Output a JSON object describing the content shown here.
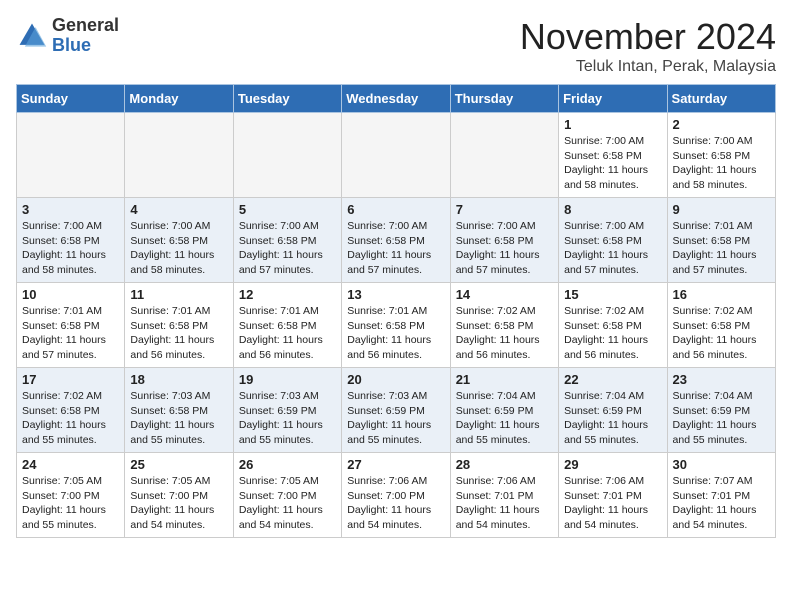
{
  "header": {
    "logo_general": "General",
    "logo_blue": "Blue",
    "month_title": "November 2024",
    "location": "Teluk Intan, Perak, Malaysia"
  },
  "weekdays": [
    "Sunday",
    "Monday",
    "Tuesday",
    "Wednesday",
    "Thursday",
    "Friday",
    "Saturday"
  ],
  "weeks": [
    {
      "days": [
        {
          "num": "",
          "info": "",
          "empty": true
        },
        {
          "num": "",
          "info": "",
          "empty": true
        },
        {
          "num": "",
          "info": "",
          "empty": true
        },
        {
          "num": "",
          "info": "",
          "empty": true
        },
        {
          "num": "",
          "info": "",
          "empty": true
        },
        {
          "num": "1",
          "info": "Sunrise: 7:00 AM\nSunset: 6:58 PM\nDaylight: 11 hours\nand 58 minutes.",
          "empty": false
        },
        {
          "num": "2",
          "info": "Sunrise: 7:00 AM\nSunset: 6:58 PM\nDaylight: 11 hours\nand 58 minutes.",
          "empty": false
        }
      ]
    },
    {
      "days": [
        {
          "num": "3",
          "info": "Sunrise: 7:00 AM\nSunset: 6:58 PM\nDaylight: 11 hours\nand 58 minutes.",
          "empty": false
        },
        {
          "num": "4",
          "info": "Sunrise: 7:00 AM\nSunset: 6:58 PM\nDaylight: 11 hours\nand 58 minutes.",
          "empty": false
        },
        {
          "num": "5",
          "info": "Sunrise: 7:00 AM\nSunset: 6:58 PM\nDaylight: 11 hours\nand 57 minutes.",
          "empty": false
        },
        {
          "num": "6",
          "info": "Sunrise: 7:00 AM\nSunset: 6:58 PM\nDaylight: 11 hours\nand 57 minutes.",
          "empty": false
        },
        {
          "num": "7",
          "info": "Sunrise: 7:00 AM\nSunset: 6:58 PM\nDaylight: 11 hours\nand 57 minutes.",
          "empty": false
        },
        {
          "num": "8",
          "info": "Sunrise: 7:00 AM\nSunset: 6:58 PM\nDaylight: 11 hours\nand 57 minutes.",
          "empty": false
        },
        {
          "num": "9",
          "info": "Sunrise: 7:01 AM\nSunset: 6:58 PM\nDaylight: 11 hours\nand 57 minutes.",
          "empty": false
        }
      ]
    },
    {
      "days": [
        {
          "num": "10",
          "info": "Sunrise: 7:01 AM\nSunset: 6:58 PM\nDaylight: 11 hours\nand 57 minutes.",
          "empty": false
        },
        {
          "num": "11",
          "info": "Sunrise: 7:01 AM\nSunset: 6:58 PM\nDaylight: 11 hours\nand 56 minutes.",
          "empty": false
        },
        {
          "num": "12",
          "info": "Sunrise: 7:01 AM\nSunset: 6:58 PM\nDaylight: 11 hours\nand 56 minutes.",
          "empty": false
        },
        {
          "num": "13",
          "info": "Sunrise: 7:01 AM\nSunset: 6:58 PM\nDaylight: 11 hours\nand 56 minutes.",
          "empty": false
        },
        {
          "num": "14",
          "info": "Sunrise: 7:02 AM\nSunset: 6:58 PM\nDaylight: 11 hours\nand 56 minutes.",
          "empty": false
        },
        {
          "num": "15",
          "info": "Sunrise: 7:02 AM\nSunset: 6:58 PM\nDaylight: 11 hours\nand 56 minutes.",
          "empty": false
        },
        {
          "num": "16",
          "info": "Sunrise: 7:02 AM\nSunset: 6:58 PM\nDaylight: 11 hours\nand 56 minutes.",
          "empty": false
        }
      ]
    },
    {
      "days": [
        {
          "num": "17",
          "info": "Sunrise: 7:02 AM\nSunset: 6:58 PM\nDaylight: 11 hours\nand 55 minutes.",
          "empty": false
        },
        {
          "num": "18",
          "info": "Sunrise: 7:03 AM\nSunset: 6:58 PM\nDaylight: 11 hours\nand 55 minutes.",
          "empty": false
        },
        {
          "num": "19",
          "info": "Sunrise: 7:03 AM\nSunset: 6:59 PM\nDaylight: 11 hours\nand 55 minutes.",
          "empty": false
        },
        {
          "num": "20",
          "info": "Sunrise: 7:03 AM\nSunset: 6:59 PM\nDaylight: 11 hours\nand 55 minutes.",
          "empty": false
        },
        {
          "num": "21",
          "info": "Sunrise: 7:04 AM\nSunset: 6:59 PM\nDaylight: 11 hours\nand 55 minutes.",
          "empty": false
        },
        {
          "num": "22",
          "info": "Sunrise: 7:04 AM\nSunset: 6:59 PM\nDaylight: 11 hours\nand 55 minutes.",
          "empty": false
        },
        {
          "num": "23",
          "info": "Sunrise: 7:04 AM\nSunset: 6:59 PM\nDaylight: 11 hours\nand 55 minutes.",
          "empty": false
        }
      ]
    },
    {
      "days": [
        {
          "num": "24",
          "info": "Sunrise: 7:05 AM\nSunset: 7:00 PM\nDaylight: 11 hours\nand 55 minutes.",
          "empty": false
        },
        {
          "num": "25",
          "info": "Sunrise: 7:05 AM\nSunset: 7:00 PM\nDaylight: 11 hours\nand 54 minutes.",
          "empty": false
        },
        {
          "num": "26",
          "info": "Sunrise: 7:05 AM\nSunset: 7:00 PM\nDaylight: 11 hours\nand 54 minutes.",
          "empty": false
        },
        {
          "num": "27",
          "info": "Sunrise: 7:06 AM\nSunset: 7:00 PM\nDaylight: 11 hours\nand 54 minutes.",
          "empty": false
        },
        {
          "num": "28",
          "info": "Sunrise: 7:06 AM\nSunset: 7:01 PM\nDaylight: 11 hours\nand 54 minutes.",
          "empty": false
        },
        {
          "num": "29",
          "info": "Sunrise: 7:06 AM\nSunset: 7:01 PM\nDaylight: 11 hours\nand 54 minutes.",
          "empty": false
        },
        {
          "num": "30",
          "info": "Sunrise: 7:07 AM\nSunset: 7:01 PM\nDaylight: 11 hours\nand 54 minutes.",
          "empty": false
        }
      ]
    }
  ]
}
